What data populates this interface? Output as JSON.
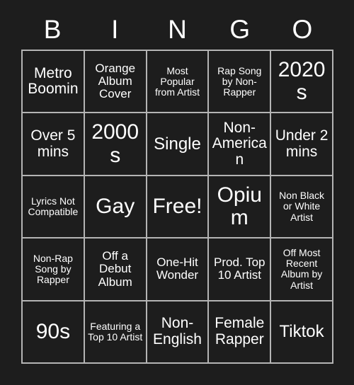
{
  "card": {
    "title": "BINGO",
    "background_color": "#1d1d1d",
    "text_color": "#ffffff",
    "grid_line_color": "#b4b4b4",
    "header": {
      "letters": [
        "B",
        "I",
        "N",
        "G",
        "O"
      ]
    },
    "rows": [
      [
        {
          "label": "Metro Boomin"
        },
        {
          "label": "Orange Album Cover"
        },
        {
          "label": "Most Popular from Artist"
        },
        {
          "label": "Rap Song by Non-Rapper"
        },
        {
          "label": "2020s"
        }
      ],
      [
        {
          "label": "Over 5 mins"
        },
        {
          "label": "2000s"
        },
        {
          "label": "Single"
        },
        {
          "label": "Non-American"
        },
        {
          "label": "Under 2 mins"
        }
      ],
      [
        {
          "label": "Lyrics Not Compatible"
        },
        {
          "label": "Gay"
        },
        {
          "label": "Free!"
        },
        {
          "label": "Opium"
        },
        {
          "label": "Non Black or White Artist"
        }
      ],
      [
        {
          "label": "Non-Rap Song by Rapper"
        },
        {
          "label": "Off a Debut Album"
        },
        {
          "label": "One-Hit Wonder"
        },
        {
          "label": "Prod. Top 10 Artist"
        },
        {
          "label": "Off Most Recent Album by Artist"
        }
      ],
      [
        {
          "label": "90s"
        },
        {
          "label": "Featuring a Top 10 Artist"
        },
        {
          "label": "Non-English"
        },
        {
          "label": "Female Rapper"
        },
        {
          "label": "Tiktok"
        }
      ]
    ]
  }
}
